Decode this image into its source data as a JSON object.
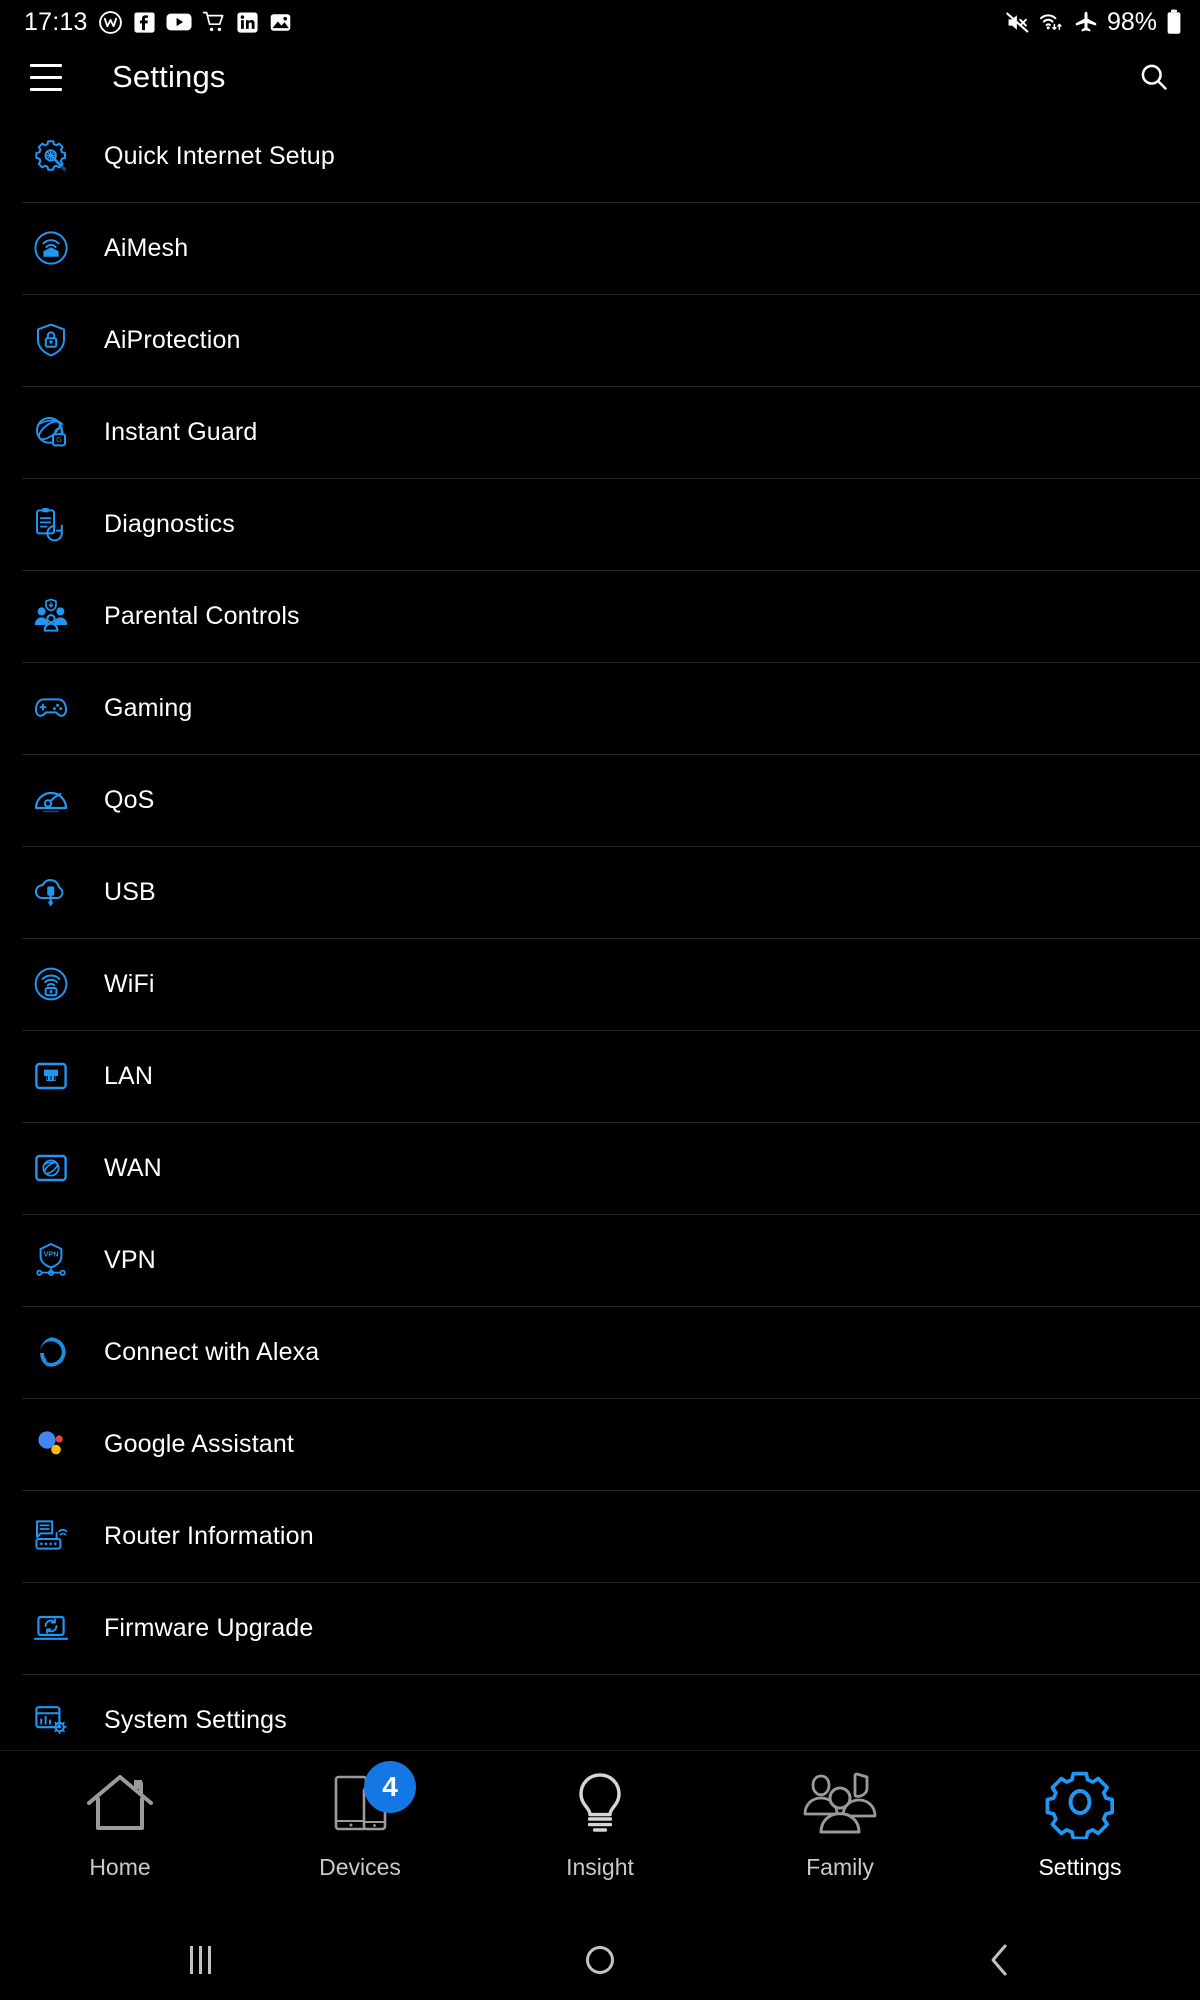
{
  "status_bar": {
    "time": "17:13",
    "left_icons": [
      "workplace-icon",
      "facebook-icon",
      "youtube-icon",
      "shopping-cart-icon",
      "linkedin-icon",
      "photos-icon"
    ],
    "right_icons": [
      "mute-icon",
      "wifi-icon",
      "airplane-mode-icon"
    ],
    "battery_percent": "98%",
    "battery_icon": "battery-icon"
  },
  "header": {
    "menu_icon": "hamburger-menu-icon",
    "title": "Settings",
    "search_icon": "search-icon"
  },
  "settings_list": [
    {
      "label": "Quick Internet Setup",
      "icon": "gear-wand-icon"
    },
    {
      "label": "AiMesh",
      "icon": "mesh-home-icon"
    },
    {
      "label": "AiProtection",
      "icon": "shield-lock-icon"
    },
    {
      "label": "Instant Guard",
      "icon": "globe-lock-icon"
    },
    {
      "label": "Diagnostics",
      "icon": "clipboard-diagnostics-icon"
    },
    {
      "label": "Parental Controls",
      "icon": "family-shield-icon"
    },
    {
      "label": "Gaming",
      "icon": "gamepad-icon"
    },
    {
      "label": "QoS",
      "icon": "speedometer-icon"
    },
    {
      "label": "USB",
      "icon": "usb-cloud-icon"
    },
    {
      "label": "WiFi",
      "icon": "wifi-router-icon"
    },
    {
      "label": "LAN",
      "icon": "ethernet-port-icon"
    },
    {
      "label": "WAN",
      "icon": "globe-square-icon"
    },
    {
      "label": "VPN",
      "icon": "vpn-shield-icon"
    },
    {
      "label": "Connect with Alexa",
      "icon": "alexa-ring-icon"
    },
    {
      "label": "Google Assistant",
      "icon": "google-assistant-icon"
    },
    {
      "label": "Router Information",
      "icon": "router-info-icon"
    },
    {
      "label": "Firmware Upgrade",
      "icon": "firmware-upgrade-icon"
    },
    {
      "label": "System Settings",
      "icon": "system-settings-icon"
    }
  ],
  "tab_bar": [
    {
      "label": "Home",
      "icon": "home-icon",
      "active": false,
      "badge": null
    },
    {
      "label": "Devices",
      "icon": "devices-icon",
      "active": false,
      "badge": "4"
    },
    {
      "label": "Insight",
      "icon": "lightbulb-icon",
      "active": false,
      "badge": null
    },
    {
      "label": "Family",
      "icon": "family-icon",
      "active": false,
      "badge": null
    },
    {
      "label": "Settings",
      "icon": "gear-icon",
      "active": true,
      "badge": null
    }
  ],
  "android_nav": {
    "recents": "recents-icon",
    "home": "home-circle-icon",
    "back": "back-chevron-icon"
  },
  "colors": {
    "accent_blue": "#2196f3",
    "badge_blue": "#1577e3",
    "background": "#000000",
    "divider": "#232323",
    "text_primary": "#ffffff",
    "tab_inactive": "#9a9a9a",
    "google_blue": "#4285f4",
    "google_red": "#ea4335",
    "google_yellow": "#fbbc05"
  }
}
